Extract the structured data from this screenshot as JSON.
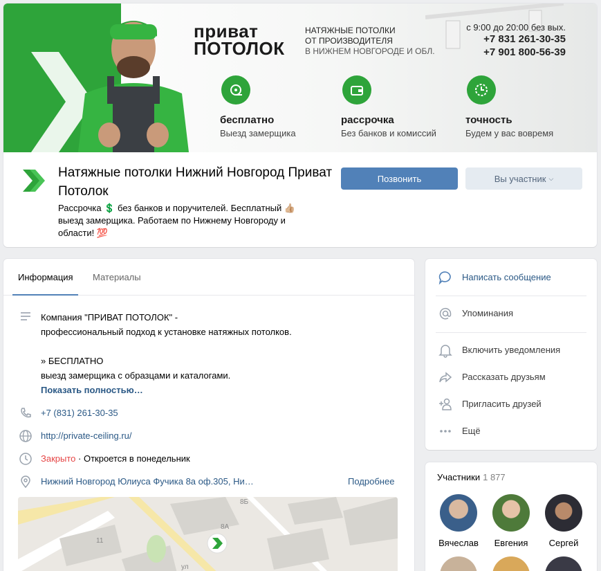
{
  "cover": {
    "brand_line1": "приват",
    "brand_line2": "ПОТОЛОК",
    "slogan_line1": "НАТЯЖНЫЕ ПОТОЛКИ",
    "slogan_line2": "ОТ ПРОИЗВОДИТЕЛЯ",
    "slogan_line3": "В НИЖНЕМ НОВГОРОДЕ И ОБЛ.",
    "hours": "с 9:00 до 20:00 без вых.",
    "phone1": "+7 831 261-30-35",
    "phone2": "+7 901 800-56-39",
    "features": [
      {
        "title": "бесплатно",
        "subtitle": "Выезд замерщика",
        "icon": "tape-measure-icon"
      },
      {
        "title": "рассрочка",
        "subtitle": "Без банков и комиссий",
        "icon": "wallet-icon"
      },
      {
        "title": "точность",
        "subtitle": "Будем у вас вовремя",
        "icon": "clock-icon"
      }
    ],
    "accent_color": "#2ea43a"
  },
  "group": {
    "title": "Натяжные потолки Нижний Новгород Приват Потолок",
    "status": "Рассрочка 💲 без банков и поручителей. Бесплатный 👍🏼 выезд замерщика. Работаем по Нижнему Новгороду и области! 💯",
    "call_button": "Позвонить",
    "member_button": "Вы участник"
  },
  "tabs": [
    {
      "label": "Информация"
    },
    {
      "label": "Материалы"
    }
  ],
  "info": {
    "description": "Компания \"ПРИВАТ ПОТОЛОК\" -\nпрофессиональный подход к установке натяжных потолков.\n\n» БЕСПЛАТНО\nвыезд замерщика с образцами и каталогами.",
    "show_more": "Показать полностью…",
    "phone": "+7 (831) 261-30-35",
    "site": "http://private-ceiling.ru/",
    "closed": "Закрыто",
    "opens": "· Откроется в понедельник",
    "address": "Нижний Новгород Юлиуса Фучика 8а оф.305, Ни…",
    "details": "Подробнее",
    "map_labels": [
      "8Б",
      "8А",
      "11",
      "ул"
    ]
  },
  "actions": [
    {
      "label": "Написать сообщение",
      "icon": "message-icon"
    },
    {
      "label": "Упоминания",
      "icon": "at-icon"
    },
    {
      "label": "Включить уведомления",
      "icon": "bell-icon"
    },
    {
      "label": "Рассказать друзьям",
      "icon": "share-icon"
    },
    {
      "label": "Пригласить друзей",
      "icon": "add-user-icon"
    },
    {
      "label": "Ещё",
      "icon": "more-icon"
    }
  ],
  "members": {
    "title": "Участники",
    "count": "1 877",
    "people": [
      {
        "name": "Вячеслав"
      },
      {
        "name": "Евгения"
      },
      {
        "name": "Сергей"
      }
    ]
  }
}
